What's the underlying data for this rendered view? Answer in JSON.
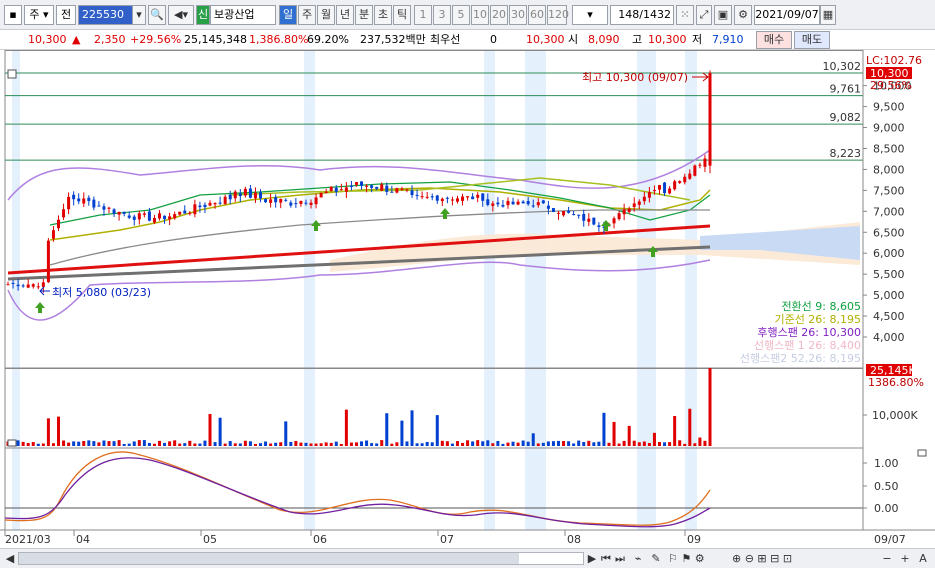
{
  "toolbar": {
    "market": "주",
    "period_mode": "전",
    "stock_code": "225530",
    "stock_name": "보광산업",
    "badge_sin": "신",
    "tabs": [
      "일",
      "주",
      "월",
      "년",
      "분",
      "초",
      "틱"
    ],
    "num_tabs": [
      "1",
      "3",
      "5",
      "10",
      "20",
      "30",
      "60",
      "120"
    ],
    "count": "148",
    "total": "/1432",
    "date": "2021/09/07"
  },
  "info": {
    "price": "10,300",
    "change": "2,350",
    "change_pct": "+29.56%",
    "volume": "25,145,348",
    "volume_pct": "1,386.80%",
    "turnover": "69.20%",
    "amount": "237,532백만",
    "priority_label": "최우선",
    "priority_value": "0",
    "ask": "10,300",
    "open_label": "시",
    "open": "8,090",
    "high_label": "고",
    "high": "10,300",
    "low_label": "저",
    "low": "7,910",
    "buy": "매수",
    "sell": "매도"
  },
  "colors": {
    "up": "#e00000",
    "down": "#0040d0",
    "ma_red": "#e01010",
    "ma_gray": "#707070",
    "bb": "#b080e0",
    "ichi_conv": "#10a040",
    "ichi_base": "#b0b000",
    "ichi_lag": "#8020c0",
    "line_h": "#2e8b57"
  },
  "chart_data": {
    "type": "candlestick",
    "x_months": [
      "2021/03",
      "04",
      "05",
      "06",
      "07",
      "08",
      "09"
    ],
    "bottom_right_label": "09/07",
    "price_axis": [
      "10,000",
      "9,500",
      "9,000",
      "8,500",
      "8,000",
      "7,500",
      "7,000",
      "6,500",
      "6,000",
      "5,500",
      "5,000",
      "4,500",
      "4,000"
    ],
    "hlines": [
      {
        "value": 10302,
        "label": "10,302"
      },
      {
        "value": 9761,
        "label": "9,761"
      },
      {
        "value": 9082,
        "label": "9,082"
      },
      {
        "value": 8223,
        "label": "8,223"
      }
    ],
    "lc": "LC:102.76",
    "last_price": "10,300",
    "last_pct": "29.56%",
    "high_note": "최고 10,300 (09/07)",
    "low_note": "최저 5,080 (03/23)",
    "legend": [
      {
        "text": "전환선 9: 8,605",
        "color": "#10a040"
      },
      {
        "text": "기준선 26: 8,195",
        "color": "#b0b000"
      },
      {
        "text": "후행스팬 26: 10,300",
        "color": "#8020c0"
      },
      {
        "text": "선행스팬 1 26: 8,400",
        "color": "#e06080"
      },
      {
        "text": "선행스팬2 52,26: 8,195",
        "color": "#8090c0"
      }
    ],
    "volume_axis": [
      "10,000K"
    ],
    "volume_last": "25,145K",
    "volume_pct": "1386.80%",
    "osc_axis": [
      "1.00",
      "0.50",
      "0.00"
    ]
  },
  "bottom": {
    "left_arrow": "◀",
    "right_arrow": "▶",
    "minus": "−",
    "plus": "+",
    "a": "A"
  }
}
